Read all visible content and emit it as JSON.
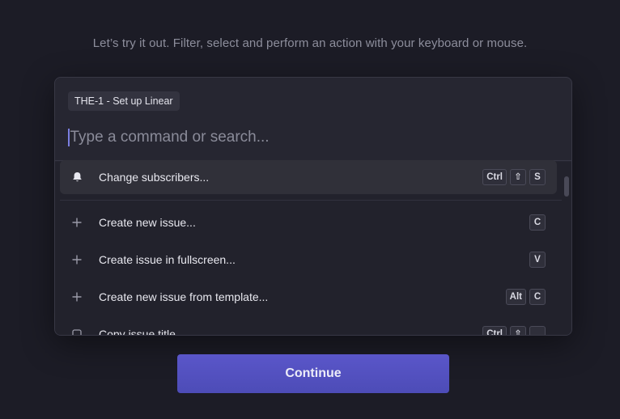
{
  "intro_text": "Let’s try it out. Filter, select and perform an action with your keyboard or mouse.",
  "palette": {
    "context_chip": "THE-1 - Set up Linear",
    "search_placeholder": "Type a command or search...",
    "items": [
      {
        "icon": "bell-icon",
        "label": "Change subscribers...",
        "keys": [
          "Ctrl",
          "⇧",
          "S"
        ],
        "active": true
      },
      {
        "icon": "plus-icon",
        "label": "Create new issue...",
        "keys": [
          "C"
        ]
      },
      {
        "icon": "plus-icon",
        "label": "Create issue in fullscreen...",
        "keys": [
          "V"
        ]
      },
      {
        "icon": "plus-icon",
        "label": "Create new issue from template...",
        "keys": [
          "Alt",
          "C"
        ]
      },
      {
        "icon": "square-icon",
        "label": "Copy issue title...",
        "keys": [
          "Ctrl",
          "⇧",
          "."
        ]
      }
    ]
  },
  "continue_label": "Continue",
  "colors": {
    "accent": "#5551c4",
    "background": "#1c1c26",
    "panel": "#262631"
  }
}
